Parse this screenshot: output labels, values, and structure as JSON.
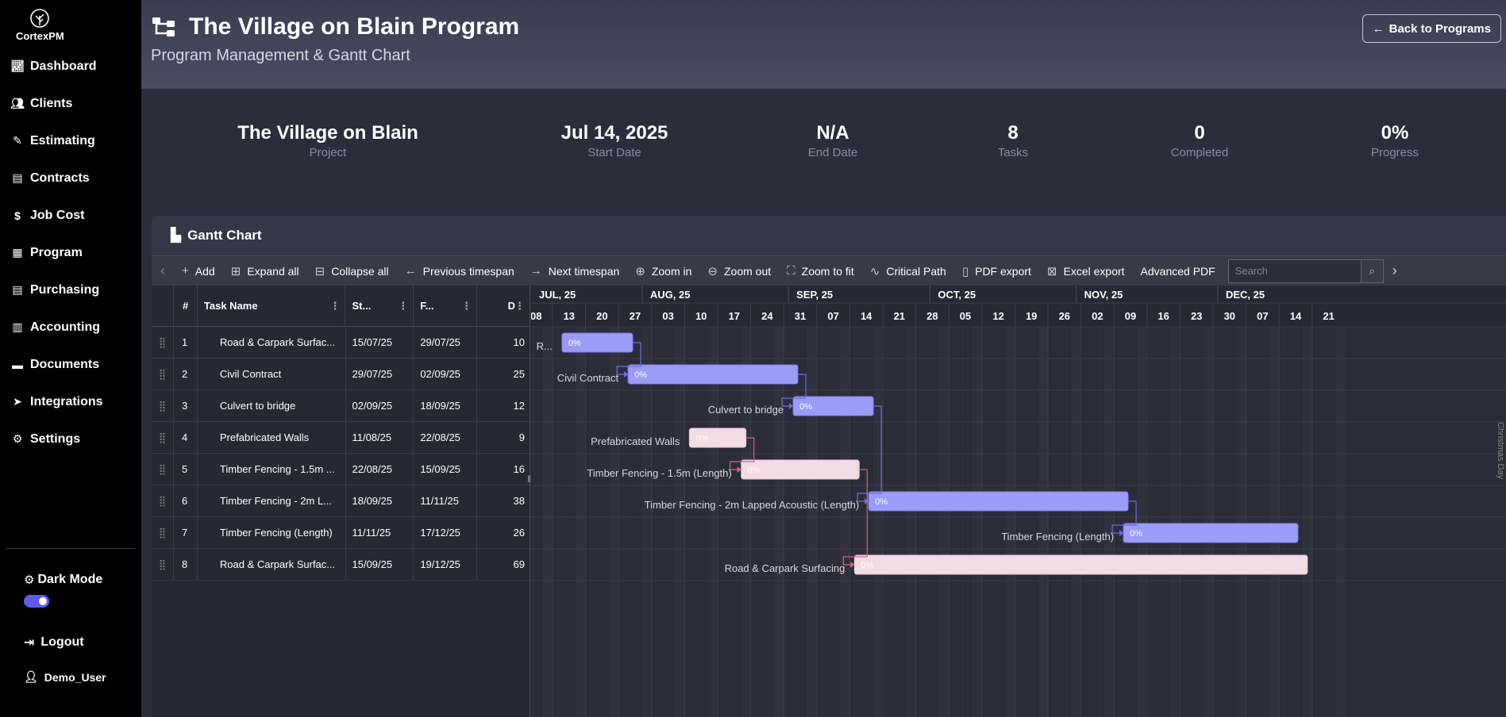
{
  "sidebar": {
    "logo_text": "CortexPM",
    "items": [
      {
        "label": "Dashboard",
        "icon": "chart-line-icon"
      },
      {
        "label": "Clients",
        "icon": "users-icon"
      },
      {
        "label": "Estimating",
        "icon": "tools-icon"
      },
      {
        "label": "Contracts",
        "icon": "file-contract-icon"
      },
      {
        "label": "Job Cost",
        "icon": "dollar-icon"
      },
      {
        "label": "Program",
        "icon": "calendar-icon"
      },
      {
        "label": "Purchasing",
        "icon": "file-invoice-icon"
      },
      {
        "label": "Accounting",
        "icon": "calculator-icon"
      },
      {
        "label": "Documents",
        "icon": "folder-icon"
      },
      {
        "label": "Integrations",
        "icon": "paper-plane-icon"
      },
      {
        "label": "Settings",
        "icon": "gear-icon"
      }
    ],
    "dark_mode_label": "Dark Mode",
    "logout_label": "Logout",
    "user_label": "Demo_User"
  },
  "header": {
    "title": "The Village on Blain Program",
    "subtitle": "Program Management & Gantt Chart",
    "back_label": "Back to Programs"
  },
  "stats": [
    {
      "value": "The Village on Blain",
      "label": "Project"
    },
    {
      "value": "Jul 14, 2025",
      "label": "Start Date"
    },
    {
      "value": "N/A",
      "label": "End Date"
    },
    {
      "value": "8",
      "label": "Tasks"
    },
    {
      "value": "0",
      "label": "Completed"
    },
    {
      "value": "0%",
      "label": "Progress"
    }
  ],
  "gantt": {
    "title": "Gantt Chart",
    "toolbar": {
      "add": "Add",
      "expand_all": "Expand all",
      "collapse_all": "Collapse all",
      "previous_timespan": "Previous timespan",
      "next_timespan": "Next timespan",
      "zoom_in": "Zoom in",
      "zoom_out": "Zoom out",
      "zoom_to_fit": "Zoom to fit",
      "critical_path": "Critical Path",
      "pdf_export": "PDF export",
      "excel_export": "Excel export",
      "advanced_pdf": "Advanced PDF",
      "search_placeholder": "Search"
    },
    "columns": {
      "num": "#",
      "name": "Task Name",
      "start": "St...",
      "finish": "F...",
      "duration": "D"
    },
    "months": [
      "JUL, 25",
      "AUG, 25",
      "SEP, 25",
      "OCT, 25",
      "NOV, 25",
      "DEC, 25"
    ],
    "weeks": [
      "08",
      "13",
      "20",
      "27",
      "03",
      "10",
      "17",
      "24",
      "31",
      "07",
      "14",
      "21",
      "28",
      "05",
      "12",
      "19",
      "26",
      "02",
      "09",
      "16",
      "23",
      "30",
      "07",
      "14",
      "21"
    ],
    "holiday_label": "Christmas Day",
    "tasks": [
      {
        "num": "1",
        "name": "Road & Carpark Surfac...",
        "full": "R...",
        "start": "15/07/25",
        "finish": "29/07/25",
        "dur": "10",
        "progress": "0%",
        "critical": true
      },
      {
        "num": "2",
        "name": "Civil Contract",
        "full": "Civil Contract",
        "start": "29/07/25",
        "finish": "02/09/25",
        "dur": "25",
        "progress": "0%",
        "critical": true
      },
      {
        "num": "3",
        "name": "Culvert to bridge",
        "full": "Culvert to bridge",
        "start": "02/09/25",
        "finish": "18/09/25",
        "dur": "12",
        "progress": "0%",
        "critical": true
      },
      {
        "num": "4",
        "name": "Prefabricated Walls",
        "full": "Prefabricated Walls",
        "start": "11/08/25",
        "finish": "22/08/25",
        "dur": "9",
        "progress": "0%",
        "critical": false
      },
      {
        "num": "5",
        "name": "Timber Fencing - 1.5m ...",
        "full": "Timber Fencing - 1.5m (Length)",
        "start": "22/08/25",
        "finish": "15/09/25",
        "dur": "16",
        "progress": "0%",
        "critical": false
      },
      {
        "num": "6",
        "name": "Timber Fencing - 2m L...",
        "full": "Timber Fencing - 2m Lapped Acoustic (Length)",
        "start": "18/09/25",
        "finish": "11/11/25",
        "dur": "38",
        "progress": "0%",
        "critical": true
      },
      {
        "num": "7",
        "name": "Timber Fencing (Length)",
        "full": "Timber Fencing (Length)",
        "start": "11/11/25",
        "finish": "17/12/25",
        "dur": "26",
        "progress": "0%",
        "critical": true
      },
      {
        "num": "8",
        "name": "Road & Carpark Surfac...",
        "full": "Road & Carpark Surfacing",
        "start": "15/09/25",
        "finish": "19/12/25",
        "dur": "69",
        "progress": "0%",
        "critical": false
      }
    ],
    "colors": {
      "critical": "#9a9cf7",
      "normal": "#f3dde4",
      "critical_line": "#6a6cf0",
      "normal_line": "#e06080"
    }
  }
}
